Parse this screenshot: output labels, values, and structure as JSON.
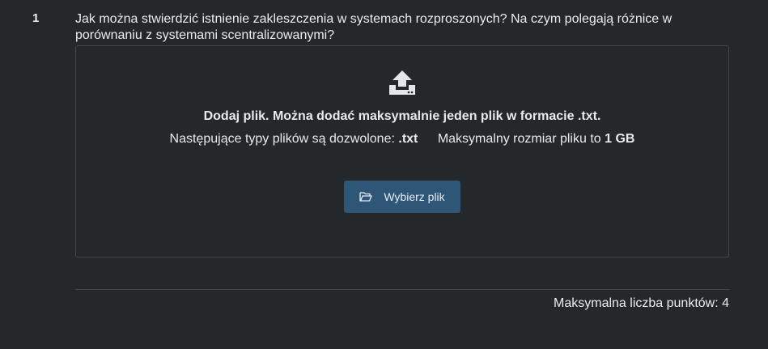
{
  "question": {
    "number": "1",
    "text": "Jak można stwierdzić istnienie zakleszczenia w systemach rozproszonych? Na czym polegają różnice w porównaniu z systemami scentralizowanymi?"
  },
  "upload": {
    "icon": "upload-icon",
    "title": "Dodaj plik. Można dodać maksymalnie jeden plik w formacie .txt.",
    "allowed_label": "Następujące typy plików są dozwolone:",
    "allowed_types": ".txt",
    "max_size_label": "Maksymalny rozmiar pliku to",
    "max_size": "1 GB",
    "button_icon": "folder-open-icon",
    "button_label": "Wybierz plik"
  },
  "footer": {
    "max_points": "Maksymalna liczba punktów: 4"
  },
  "colors": {
    "background": "#25282b",
    "button": "#2e5677",
    "border": "#43474b"
  }
}
